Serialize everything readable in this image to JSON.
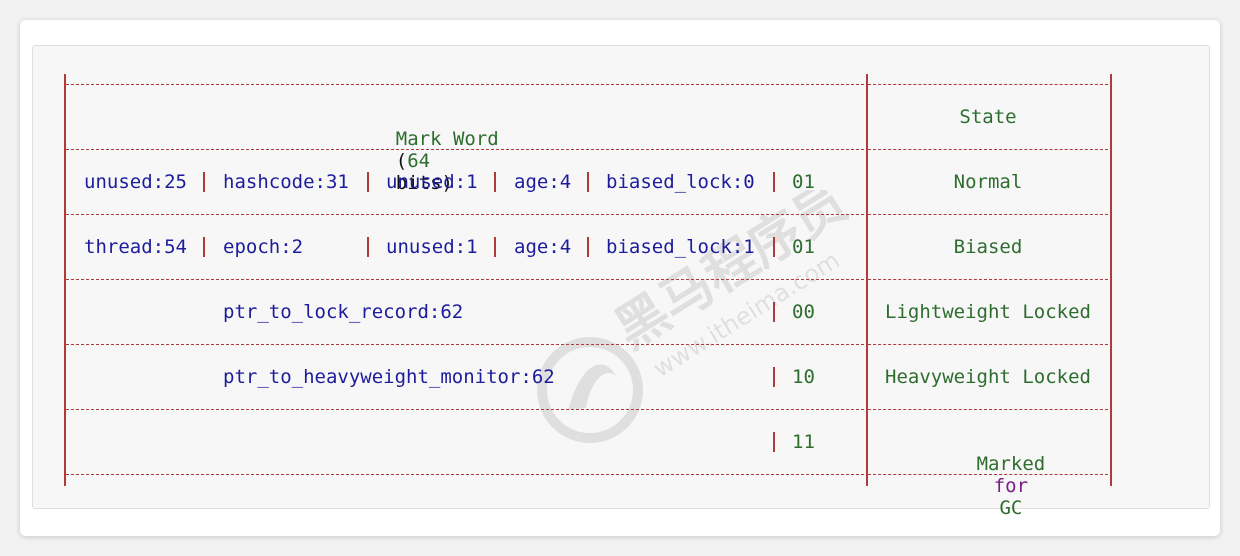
{
  "table": {
    "header": {
      "mark_word": "Mark Word",
      "paren_open": "(",
      "bits_number": "64",
      "bits_word": "bits",
      "paren_close": ")",
      "state": "State"
    },
    "rows": [
      {
        "fields": [
          "unused:25",
          "hashcode:31",
          "unused:1",
          "age:4",
          "biased_lock:0"
        ],
        "bits": "01",
        "state": "Normal"
      },
      {
        "fields": [
          "thread:54",
          "epoch:2",
          "unused:1",
          "age:4",
          "biased_lock:1"
        ],
        "bits": "01",
        "state": "Biased"
      },
      {
        "field": "ptr_to_lock_record:62",
        "bits": "00",
        "state": "Lightweight Locked"
      },
      {
        "field": "ptr_to_heavyweight_monitor:62",
        "bits": "10",
        "state": "Heavyweight Locked"
      },
      {
        "field": "",
        "bits": "11",
        "state": {
          "part1": "Marked",
          "part2": "for",
          "part3": "GC"
        }
      }
    ]
  },
  "colors": {
    "border": "#b03a3a",
    "field_blue": "#1c1c9c",
    "value_green": "#2f6d2f",
    "keyword_purple": "#7a1f84"
  }
}
